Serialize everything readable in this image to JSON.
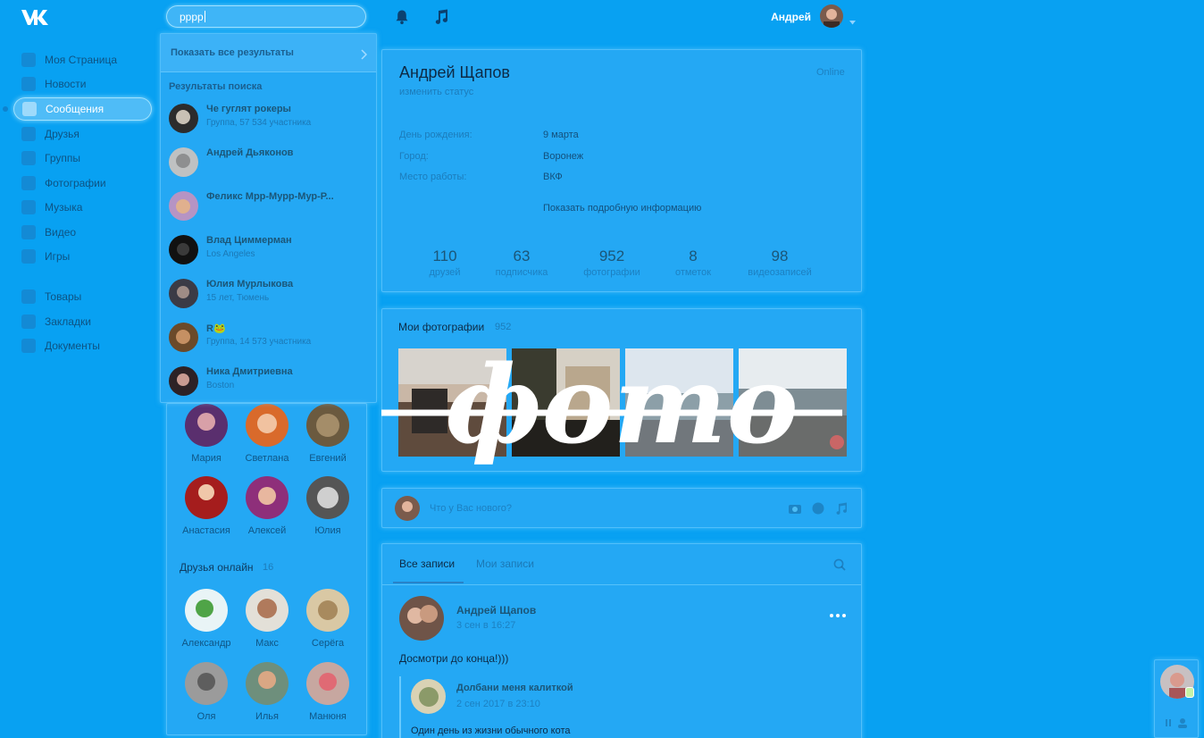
{
  "colors": {
    "background": "#08a1f2",
    "accent": "#b9e9ff",
    "text_dark": "#0d2a45"
  },
  "header": {
    "logo_icon": "vk-logo-icon",
    "search": {
      "value": "рррр"
    },
    "bell_icon": "bell-icon",
    "music_icon": "music-icon",
    "user_name": "Андрей"
  },
  "nav": {
    "items": [
      {
        "label": "Моя Страница",
        "icon": "home-icon"
      },
      {
        "label": "Новости",
        "icon": "news-icon"
      },
      {
        "label": "Сообщения",
        "icon": "messages-icon",
        "active": true
      },
      {
        "label": "Друзья",
        "icon": "friends-icon"
      },
      {
        "label": "Группы",
        "icon": "groups-icon"
      },
      {
        "label": "Фотографии",
        "icon": "camera-icon"
      },
      {
        "label": "Музыка",
        "icon": "music-icon"
      },
      {
        "label": "Видео",
        "icon": "video-icon"
      },
      {
        "label": "Игры",
        "icon": "games-icon"
      },
      {
        "label": "Товары",
        "icon": "shop-icon"
      },
      {
        "label": "Закладки",
        "icon": "star-icon"
      },
      {
        "label": "Документы",
        "icon": "document-icon"
      }
    ]
  },
  "search_dropdown": {
    "show_all": "Показать все результаты",
    "results_heading": "Результаты поиска",
    "results": [
      {
        "name": "Че гуглят рокеры",
        "sub": "Группа, 57 534 участника"
      },
      {
        "name": "Андрей Дьяконов",
        "sub": ""
      },
      {
        "name": "Феликс Мрр-Мурр-Мур-Р...",
        "sub": ""
      },
      {
        "name": "Влад Циммерман",
        "sub": "Los Angeles"
      },
      {
        "name": "Юлия Мурлыкова",
        "sub": "15 лет, Тюмень"
      },
      {
        "name": "R🐸",
        "sub": "Группа, 14 573 участника"
      },
      {
        "name": "Ника Дмитриевна",
        "sub": "Boston"
      }
    ]
  },
  "friends": {
    "list": [
      {
        "name": "Мария"
      },
      {
        "name": "Светлана"
      },
      {
        "name": "Евгений"
      },
      {
        "name": "Анастасия"
      },
      {
        "name": "Алексей"
      },
      {
        "name": "Юлия"
      }
    ],
    "online_title": "Друзья онлайн",
    "online_count": "16",
    "online": [
      {
        "name": "Александр"
      },
      {
        "name": "Макс"
      },
      {
        "name": "Серёга"
      },
      {
        "name": "Оля"
      },
      {
        "name": "Илья"
      },
      {
        "name": "Манюня"
      }
    ]
  },
  "profile": {
    "name": "Андрей Щапов",
    "status": "изменить статус",
    "online": "Online",
    "info": [
      {
        "label": "День рождения:",
        "value": "9 марта"
      },
      {
        "label": "Город:",
        "value": "Воронеж"
      },
      {
        "label": "Место работы:",
        "value": "ВКФ"
      }
    ],
    "show_more": "Показать подробную информацию",
    "stats": [
      {
        "num": "110",
        "label": "друзей"
      },
      {
        "num": "63",
        "label": "подписчика"
      },
      {
        "num": "952",
        "label": "фотографии"
      },
      {
        "num": "8",
        "label": "отметок"
      },
      {
        "num": "98",
        "label": "видеозаписей"
      }
    ]
  },
  "photos": {
    "title": "Мои фотографии",
    "count": "952",
    "overlay_text": "фото"
  },
  "composer": {
    "placeholder": "Что у Вас нового?",
    "icons": [
      "camera-icon",
      "smile-icon",
      "music-note-icon"
    ]
  },
  "wall": {
    "tabs": [
      "Все записи",
      "Мои записи"
    ],
    "post": {
      "author": "Андрей Щапов",
      "date": "3 сен в 16:27",
      "text": "Досмотри до конца!)))",
      "repost": {
        "author": "Долбани меня калиткой",
        "date": "2 сен 2017 в 23:10",
        "text": "Один день из жизни обычного кота"
      }
    }
  }
}
